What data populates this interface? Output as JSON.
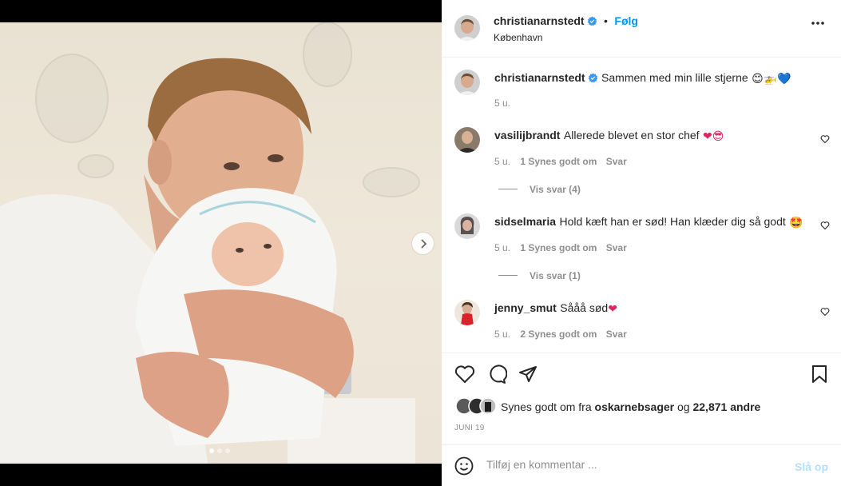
{
  "header": {
    "username": "christianarnstedt",
    "separator": "•",
    "follow_label": "Følg",
    "location": "København"
  },
  "caption": {
    "username": "christianarnstedt",
    "text": "Sammen med min lille stjerne",
    "emojis": "😊🚁💙",
    "time": "5 u."
  },
  "comments": [
    {
      "username": "vasilijbrandt",
      "text": "Allerede blevet en stor chef",
      "emojis": "❤😎",
      "time": "5 u.",
      "likes": "1 Synes godt om",
      "reply": "Svar",
      "view_replies": "Vis svar (4)"
    },
    {
      "username": "sidselmaria",
      "text": "Hold kæft han er sød! Han klæder dig så godt",
      "emojis": "🤩",
      "time": "5 u.",
      "likes": "1 Synes godt om",
      "reply": "Svar",
      "view_replies": "Vis svar (1)"
    },
    {
      "username": "jenny_smut",
      "text": "Sååå sød",
      "emojis": "❤",
      "time": "5 u.",
      "likes": "2 Synes godt om",
      "reply": "Svar"
    }
  ],
  "likes_summary": {
    "prefix": "Synes godt om fra",
    "user": "oskarnebsager",
    "conjunction": "og",
    "count": "22,871 andre"
  },
  "post_date": "JUNI 19",
  "composer": {
    "placeholder": "Tilføj en kommentar ...",
    "post_label": "Slå op"
  },
  "carousel": {
    "total": 3,
    "active": 1
  },
  "colors": {
    "accent": "#0095f6",
    "verified": "#3897f0",
    "muted": "#8e8e8e",
    "post_disabled": "#b2dffc"
  },
  "icons": [
    "verified-icon",
    "more-icon",
    "heart-icon",
    "comment-icon",
    "share-icon",
    "bookmark-icon",
    "emoji-icon",
    "chevron-right-icon"
  ]
}
